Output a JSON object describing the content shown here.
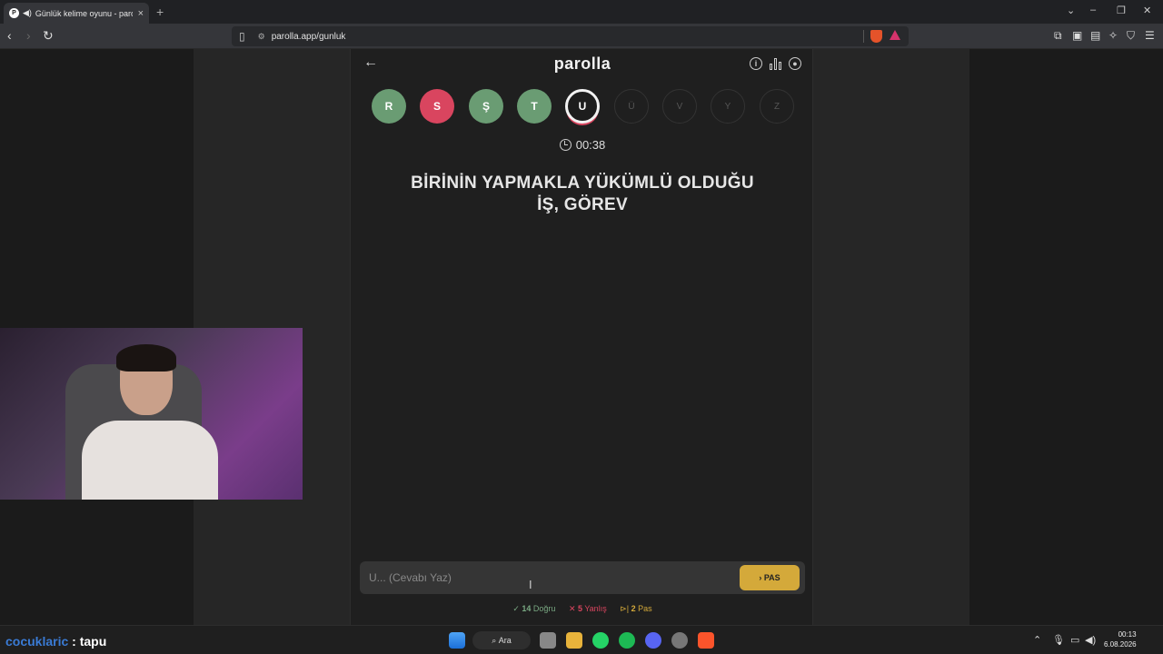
{
  "browser": {
    "tab_title": "Günlük kelime oyunu - paroll",
    "url": "parolla.app/gunluk"
  },
  "app": {
    "logo": "parolla",
    "letters": [
      {
        "char": "R",
        "state": "correct"
      },
      {
        "char": "S",
        "state": "wrong"
      },
      {
        "char": "Ş",
        "state": "correct"
      },
      {
        "char": "T",
        "state": "correct"
      },
      {
        "char": "U",
        "state": "active"
      },
      {
        "char": "Ü",
        "state": "pending"
      },
      {
        "char": "V",
        "state": "pending"
      },
      {
        "char": "Y",
        "state": "pending"
      },
      {
        "char": "Z",
        "state": "pending"
      }
    ],
    "timer": "00:38",
    "question_line1": "BİRİNİN YAPMAKLA YÜKÜMLÜ OLDUĞU",
    "question_line2": "İŞ, GÖREV",
    "input_placeholder": "U... (Cevabı Yaz)",
    "pass_button": "PAS",
    "stats": {
      "correct_count": "14",
      "correct_label": "Doğru",
      "wrong_count": "5",
      "wrong_label": "Yanlış",
      "pass_count": "2",
      "pass_label": "Pas"
    },
    "colors": {
      "correct": "#6a9c73",
      "wrong": "#d9455f",
      "pass": "#d4a93a"
    }
  },
  "overlay": {
    "chat_user": "cocuklaric",
    "chat_sep": " : ",
    "chat_message": "tapu"
  },
  "taskbar": {
    "search_label": "Ara",
    "time": "00:13",
    "date": "6.08.2026"
  }
}
